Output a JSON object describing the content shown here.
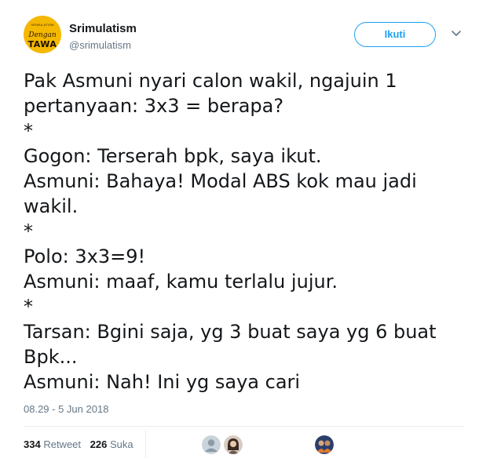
{
  "header": {
    "display_name": "Srimulatism",
    "handle": "@srimulatism",
    "follow_label": "Ikuti",
    "avatar": {
      "top_text": "SRIMULATISM",
      "script_text": "Dengan",
      "bold_text": "TAWA",
      "color": "#f5b800"
    },
    "caret_icon": "chevron-down-icon"
  },
  "tweet": {
    "lines": [
      "Pak Asmuni nyari calon wakil, ngajuin 1",
      "pertanyaan: 3x3 = berapa?",
      "*",
      "Gogon: Terserah bpk, saya ikut.",
      "Asmuni: Bahaya! Modal ABS kok mau jadi",
      "wakil.",
      "*",
      "Polo: 3x3=9!",
      "Asmuni: maaf, kamu terlalu jujur.",
      "*",
      "Tarsan: Bgini saja, yg 3 buat saya yg 6 buat",
      "Bpk...",
      "Asmuni: Nah! Ini yg saya cari"
    ],
    "timestamp": "08.29 - 5 Jun 2018"
  },
  "stats": {
    "retweet_count": "334",
    "retweet_label": "Retweet",
    "like_count": "226",
    "like_label": "Suka"
  },
  "colors": {
    "accent": "#1da1f2",
    "muted": "#657786",
    "divider": "#e6ecf0",
    "text": "#14171a"
  }
}
